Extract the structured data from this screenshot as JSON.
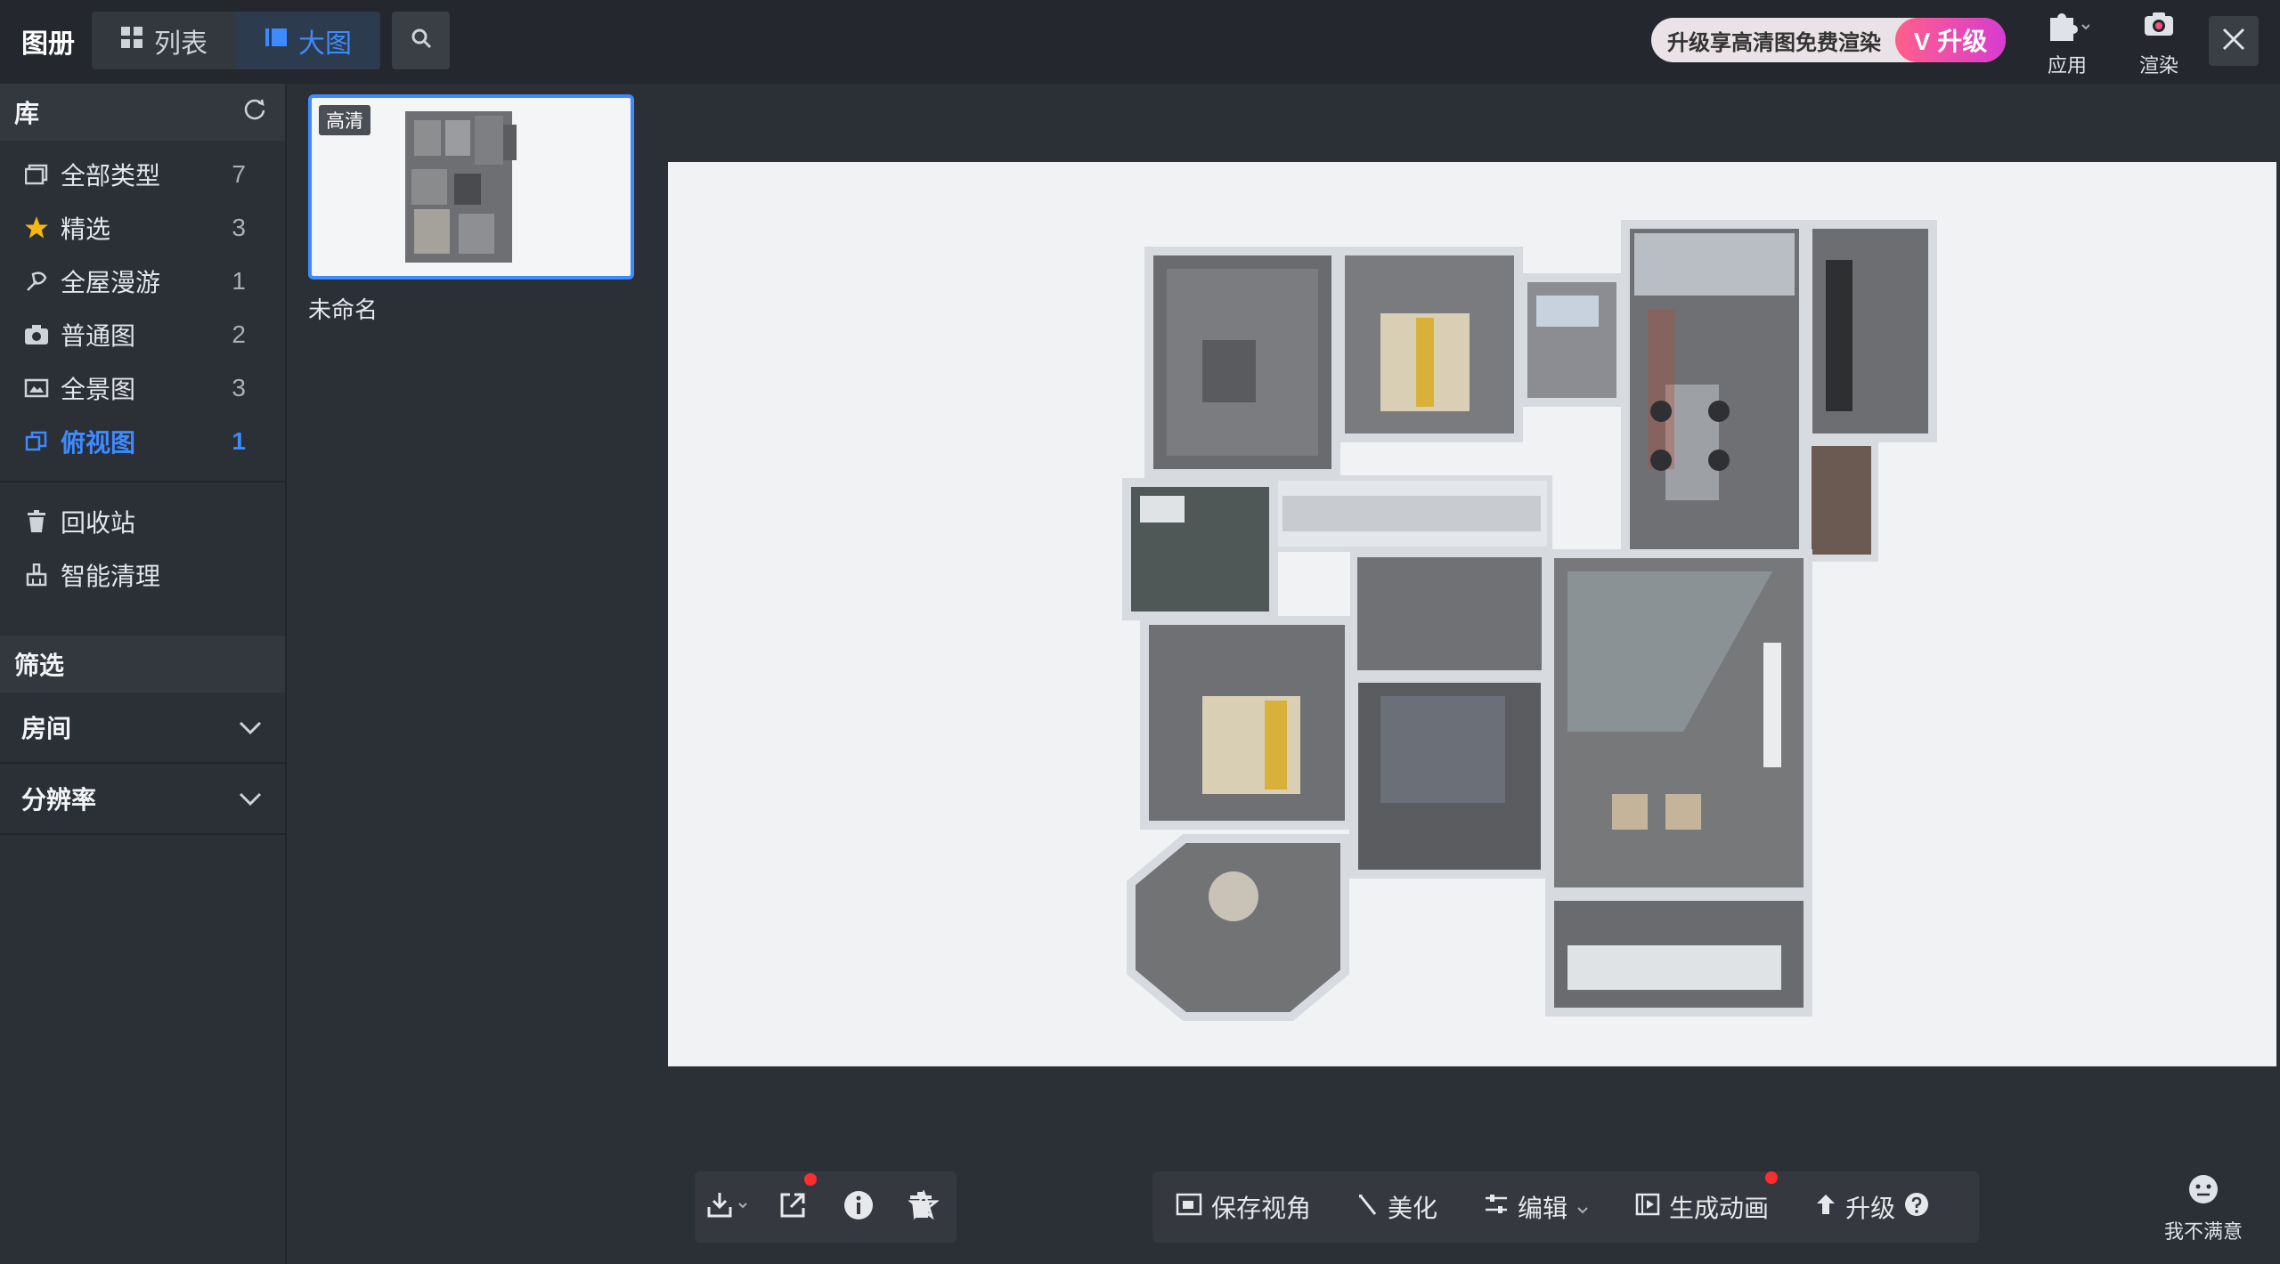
{
  "app": {
    "title": "图册"
  },
  "view_toggle": [
    {
      "label": "列表",
      "active": false
    },
    {
      "label": "大图",
      "active": true
    }
  ],
  "promo": {
    "text": "升级享高清图免费渲染",
    "vip_label": "V 升级"
  },
  "top_tools": {
    "apps_label": "应用",
    "render_label": "渲染"
  },
  "sidebar": {
    "library_title": "库",
    "items": [
      {
        "label": "全部类型",
        "count": "7",
        "icon": "image-stack-icon"
      },
      {
        "label": "精选",
        "count": "3",
        "icon": "star-icon"
      },
      {
        "label": "全屋漫游",
        "count": "1",
        "icon": "walkthrough-icon"
      },
      {
        "label": "普通图",
        "count": "2",
        "icon": "camera-icon"
      },
      {
        "label": "全景图",
        "count": "3",
        "icon": "panorama-icon"
      },
      {
        "label": "俯视图",
        "count": "1",
        "icon": "top-view-icon",
        "active": true
      }
    ],
    "extra_items": [
      {
        "label": "回收站",
        "icon": "trash-icon"
      },
      {
        "label": "智能清理",
        "icon": "broom-icon"
      }
    ],
    "filter_title": "筛选",
    "filters": [
      {
        "label": "房间"
      },
      {
        "label": "分辨率"
      }
    ]
  },
  "thumbnail": {
    "badge": "高清",
    "name": "未命名"
  },
  "toolbar": {
    "save_view": "保存视角",
    "beautify": "美化",
    "edit": "编辑",
    "animate": "生成动画",
    "upgrade": "升级"
  },
  "feedback": {
    "label": "我不满意"
  },
  "colors": {
    "accent": "#3d8bff",
    "promo_start": "#ff5f8a",
    "promo_end": "#d83bd1",
    "notify": "#ff2d2d"
  }
}
